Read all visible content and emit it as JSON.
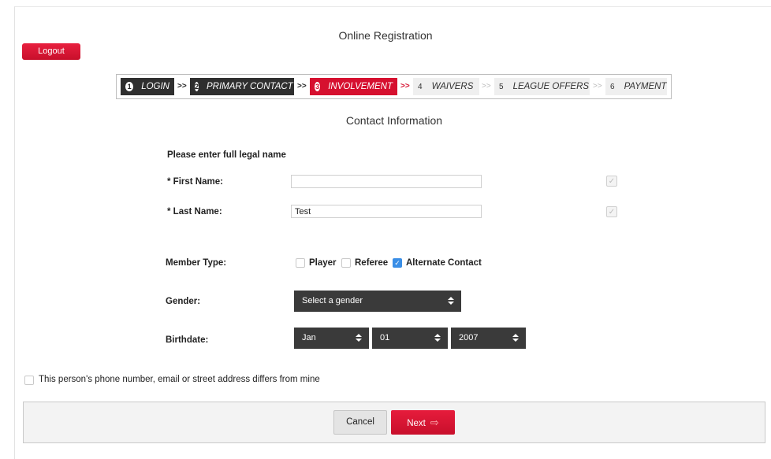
{
  "page": {
    "title": "Online Registration",
    "logout_label": "Logout"
  },
  "steps": [
    {
      "number": "1",
      "label": "LOGIN",
      "state": "done"
    },
    {
      "number": "2",
      "label": "PRIMARY CONTACT",
      "state": "done"
    },
    {
      "number": "3",
      "label": "INVOLVEMENT",
      "state": "active"
    },
    {
      "number": "4",
      "label": "WAIVERS",
      "state": "todo"
    },
    {
      "number": "5",
      "label": "LEAGUE OFFERS",
      "state": "todo"
    },
    {
      "number": "6",
      "label": "PAYMENT",
      "state": "todo"
    }
  ],
  "step_separator": ">>",
  "form": {
    "section_title": "Contact Information",
    "name_instruction": "Please enter full legal name",
    "first_name_label": "* First Name:",
    "first_name_value": "",
    "last_name_label": "* Last Name:",
    "last_name_value": "Test",
    "member_type_label": "Member Type:",
    "member_types": [
      {
        "label": "Player",
        "checked": false
      },
      {
        "label": "Referee",
        "checked": false
      },
      {
        "label": "Alternate Contact",
        "checked": true
      }
    ],
    "gender_label": "Gender:",
    "gender_value": "Select a gender",
    "birthdate_label": "Birthdate:",
    "birth_month": "Jan",
    "birth_day": "01",
    "birth_year": "2007",
    "differs_label": "This person's phone number, email or street address differs from mine",
    "differs_checked": false
  },
  "footer": {
    "cancel_label": "Cancel",
    "next_label": "Next"
  },
  "colors": {
    "accent": "#d6102f",
    "dark_step": "#2f2f2f",
    "select_bg": "#3a3a3a",
    "checkbox_checked": "#3a8ee6"
  }
}
